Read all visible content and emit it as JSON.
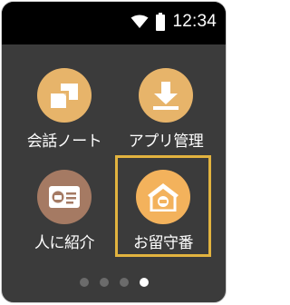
{
  "status_bar": {
    "time": "12:34",
    "icons": [
      "wifi-icon",
      "battery-icon"
    ]
  },
  "apps": [
    {
      "label": "会話ノート",
      "icon": "notes-icon",
      "color": "#e7b46a"
    },
    {
      "label": "アプリ管理",
      "icon": "download-icon",
      "color": "#e7b46a"
    },
    {
      "label": "人に紹介",
      "icon": "id-card-icon",
      "color": "#a57a63"
    },
    {
      "label": "お留守番",
      "icon": "house-robot-icon",
      "color": "#f3b25c",
      "selected": true
    }
  ],
  "pager": {
    "pages": 4,
    "active_index": 3
  },
  "colors": {
    "background": "#3b3b3b",
    "status_bar": "#000000",
    "selection_border": "#e2b33f"
  }
}
